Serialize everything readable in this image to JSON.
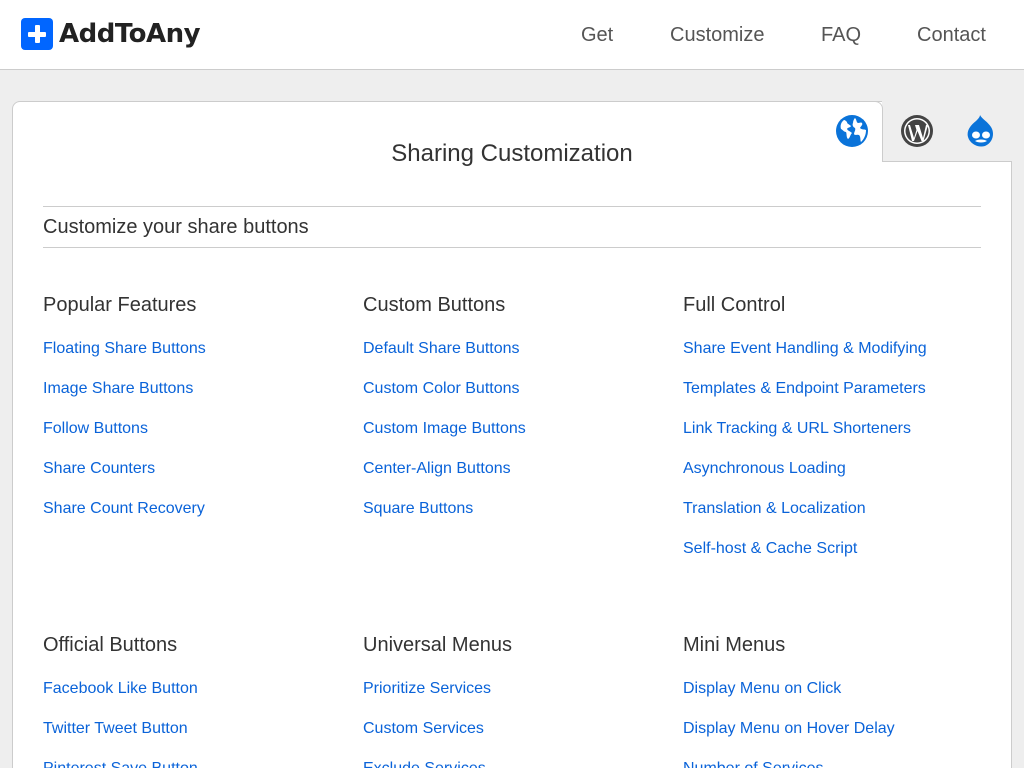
{
  "brand": {
    "name": "AddToAny"
  },
  "nav": [
    {
      "label": "Get"
    },
    {
      "label": "Customize"
    },
    {
      "label": "FAQ"
    },
    {
      "label": "Contact"
    }
  ],
  "tabs": [
    {
      "icon": "globe-icon",
      "active": true
    },
    {
      "icon": "wordpress-icon",
      "active": false
    },
    {
      "icon": "drupal-icon",
      "active": false
    }
  ],
  "page": {
    "title": "Sharing Customization",
    "section_heading": "Customize your share buttons"
  },
  "groups": [
    {
      "title": "Popular Features",
      "links": [
        "Floating Share Buttons",
        "Image Share Buttons",
        "Follow Buttons",
        "Share Counters",
        "Share Count Recovery"
      ]
    },
    {
      "title": "Custom Buttons",
      "links": [
        "Default Share Buttons",
        "Custom Color Buttons",
        "Custom Image Buttons",
        "Center-Align Buttons",
        "Square Buttons"
      ]
    },
    {
      "title": "Full Control",
      "links": [
        "Share Event Handling & Modifying",
        "Templates & Endpoint Parameters",
        "Link Tracking & URL Shorteners",
        "Asynchronous Loading",
        "Translation & Localization",
        "Self-host & Cache Script"
      ]
    },
    {
      "title": "Official Buttons",
      "links": [
        "Facebook Like Button",
        "Twitter Tweet Button",
        "Pinterest Save Button"
      ]
    },
    {
      "title": "Universal Menus",
      "links": [
        "Prioritize Services",
        "Custom Services",
        "Exclude Services"
      ]
    },
    {
      "title": "Mini Menus",
      "links": [
        "Display Menu on Click",
        "Display Menu on Hover Delay",
        "Number of Services"
      ]
    }
  ],
  "colors": {
    "link": "#0a63d9",
    "brand": "#0166ff",
    "text": "#333333",
    "background": "#eeeeee",
    "icon_blue": "#0a73d9",
    "icon_dark": "#444444"
  }
}
